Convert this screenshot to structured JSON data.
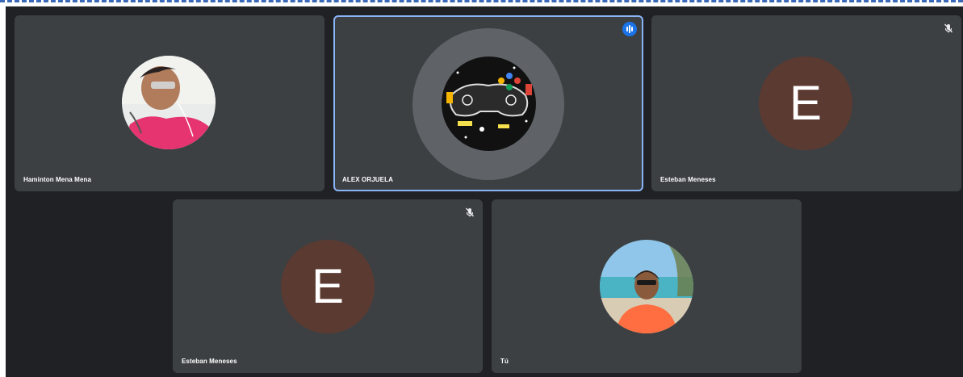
{
  "participants": [
    {
      "name": "Haminton Mena Mena",
      "type": "photo",
      "muted": false,
      "speaking": false
    },
    {
      "name": "ALEX ORJUELA",
      "type": "photo",
      "muted": false,
      "speaking": true
    },
    {
      "name": "Esteban Meneses",
      "type": "initial",
      "initial": "E",
      "muted": true,
      "speaking": false
    },
    {
      "name": "Esteban Meneses",
      "type": "initial",
      "initial": "E",
      "muted": true,
      "speaking": false
    },
    {
      "name": "Tú",
      "type": "photo",
      "muted": false,
      "speaking": false
    }
  ],
  "colors": {
    "stage_background": "#202124",
    "tile_background": "#3c4043",
    "active_outline": "#8ab4f8",
    "speaking_badge": "#1a73e8",
    "letter_avatar": "#5b3a31"
  }
}
